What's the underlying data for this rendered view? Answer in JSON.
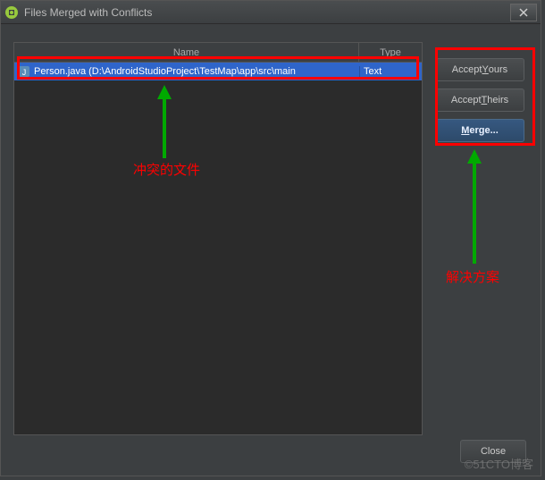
{
  "window": {
    "title": "Files Merged with Conflicts"
  },
  "table": {
    "headers": {
      "name": "Name",
      "type": "Type"
    },
    "rows": [
      {
        "name": "Person.java (D:\\AndroidStudioProject\\TestMap\\app\\src\\main",
        "type": "Text"
      }
    ]
  },
  "buttons": {
    "accept_yours_pre": "Accept ",
    "accept_yours_u": "Y",
    "accept_yours_post": "ours",
    "accept_theirs_pre": "Accept ",
    "accept_theirs_u": "T",
    "accept_theirs_post": "heirs",
    "merge_u": "M",
    "merge_post": "erge...",
    "close": "Close"
  },
  "annotations": {
    "conflict_file": "冲突的文件",
    "resolution": "解决方案"
  },
  "watermark": "©51CTO博客"
}
